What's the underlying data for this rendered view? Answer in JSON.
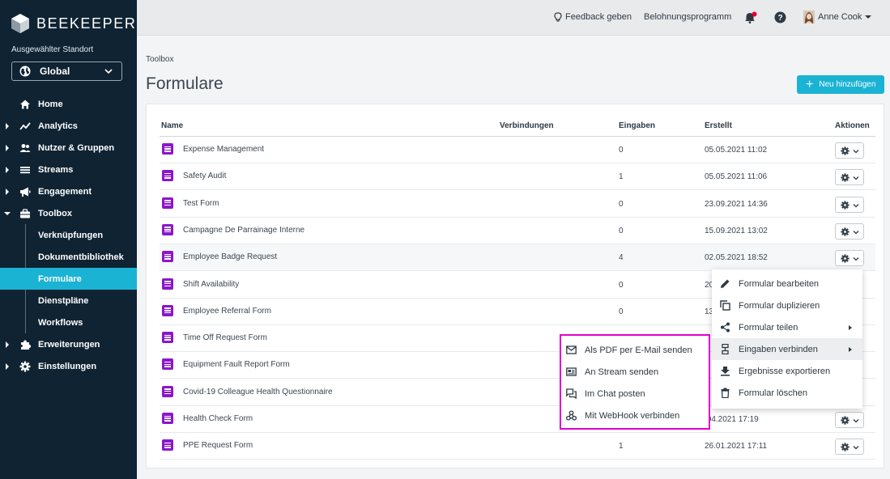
{
  "brand": {
    "name": "BEEKEEPER"
  },
  "location": {
    "label": "Ausgewählter Standort",
    "value": "Global"
  },
  "nav": {
    "items": [
      {
        "label": "Home",
        "icon": "home-icon",
        "caret": false
      },
      {
        "label": "Analytics",
        "icon": "analytics-icon",
        "caret": true
      },
      {
        "label": "Nutzer & Gruppen",
        "icon": "users-icon",
        "caret": true
      },
      {
        "label": "Streams",
        "icon": "streams-icon",
        "caret": true
      },
      {
        "label": "Engagement",
        "icon": "megaphone-icon",
        "caret": true
      },
      {
        "label": "Toolbox",
        "icon": "toolbox-icon",
        "caret": "open"
      }
    ],
    "sub_items": [
      {
        "label": "Verknüpfungen",
        "active": false
      },
      {
        "label": "Dokumentbibliothek",
        "active": false
      },
      {
        "label": "Formulare",
        "active": true
      },
      {
        "label": "Dienstpläne",
        "active": false
      },
      {
        "label": "Workflows",
        "active": false
      }
    ],
    "bottom_items": [
      {
        "label": "Erweiterungen",
        "icon": "puzzle-icon"
      },
      {
        "label": "Einstellungen",
        "icon": "gear-icon"
      }
    ]
  },
  "topbar": {
    "feedback": "Feedback geben",
    "rewards": "Belohnungsprogramm",
    "user": "Anne Cook"
  },
  "breadcrumb": "Toolbox",
  "title": "Formulare",
  "add_button": "Neu hinzufügen",
  "table": {
    "headers": {
      "name": "Name",
      "connections": "Verbindungen",
      "entries": "Eingaben",
      "created": "Erstellt",
      "actions": "Aktionen"
    },
    "rows": [
      {
        "name": "Expense Management",
        "entries": "0",
        "created": "05.05.2021 11:02"
      },
      {
        "name": "Safety Audit",
        "entries": "1",
        "created": "05.05.2021 11:06"
      },
      {
        "name": "Test Form",
        "entries": "0",
        "created": "23.09.2021 14:36"
      },
      {
        "name": "Campagne De Parrainage Interne",
        "entries": "0",
        "created": "15.09.2021 13:02"
      },
      {
        "name": "Employee Badge Request",
        "entries": "4",
        "created": "02.05.2021 18:52"
      },
      {
        "name": "Shift Availability",
        "entries": "0",
        "created": "20"
      },
      {
        "name": "Employee Referral Form",
        "entries": "0",
        "created": "13"
      },
      {
        "name": "Time Off Request Form",
        "entries": "",
        "created": ""
      },
      {
        "name": "Equipment Fault Report Form",
        "entries": "",
        "created": ""
      },
      {
        "name": "Covid-19 Colleague Health Questionnaire",
        "entries": "",
        "created": ""
      },
      {
        "name": "Health Check Form",
        "entries": "",
        "created": ".04.2021 17:19"
      },
      {
        "name": "PPE Request Form",
        "entries": "1",
        "created": "26.01.2021 17:11"
      }
    ]
  },
  "context_menu": [
    {
      "label": "Formular bearbeiten",
      "icon": "pencil-icon",
      "arrow": false
    },
    {
      "label": "Formular duplizieren",
      "icon": "duplicate-icon",
      "arrow": false
    },
    {
      "label": "Formular teilen",
      "icon": "share-icon",
      "arrow": true
    },
    {
      "label": "Eingaben verbinden",
      "icon": "connect-icon",
      "arrow": true
    },
    {
      "label": "Ergebnisse exportieren",
      "icon": "download-icon",
      "arrow": false
    },
    {
      "label": "Formular löschen",
      "icon": "trash-icon",
      "arrow": false
    }
  ],
  "submenu": [
    {
      "label": "Als PDF per E-Mail senden",
      "icon": "mail-icon"
    },
    {
      "label": "An Stream senden",
      "icon": "stream-card-icon"
    },
    {
      "label": "Im Chat posten",
      "icon": "chat-icon"
    },
    {
      "label": "Mit WebHook verbinden",
      "icon": "webhook-icon"
    }
  ],
  "colors": {
    "sidebar": "#0f2333",
    "accent": "#1bb3d4",
    "form_icon": "#8a17c9",
    "highlight": "#e000d0"
  }
}
